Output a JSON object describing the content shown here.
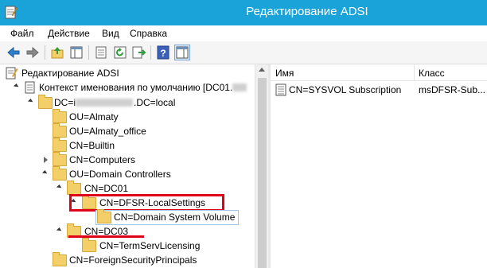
{
  "window": {
    "title": "Редактирование ADSI"
  },
  "menu": [
    "Файл",
    "Действие",
    "Вид",
    "Справка"
  ],
  "tree": {
    "root": "Редактирование ADSI",
    "context": "Контекст именования по умолчанию [DC01.",
    "domain_prefix": "DC=i",
    "domain_suffix": ".DC=local",
    "items": [
      "OU=Almaty",
      "OU=Almaty_office",
      "CN=Builtin",
      "CN=Computers",
      "OU=Domain Controllers",
      "CN=DC01",
      "CN=DFSR-LocalSettings",
      "CN=Domain System Volume",
      "CN=DC03",
      "CN=TermServLicensing",
      "CN=ForeignSecurityPrincipals"
    ]
  },
  "list": {
    "columns": [
      "Имя",
      "Класс"
    ],
    "rows": [
      {
        "name": "CN=SYSVOL Subscription",
        "class": "msDFSR-Sub..."
      }
    ]
  },
  "colors": {
    "titlebar": "#1aa3d9",
    "annotation": "#e0001a",
    "folder": "#f3cf6a"
  }
}
